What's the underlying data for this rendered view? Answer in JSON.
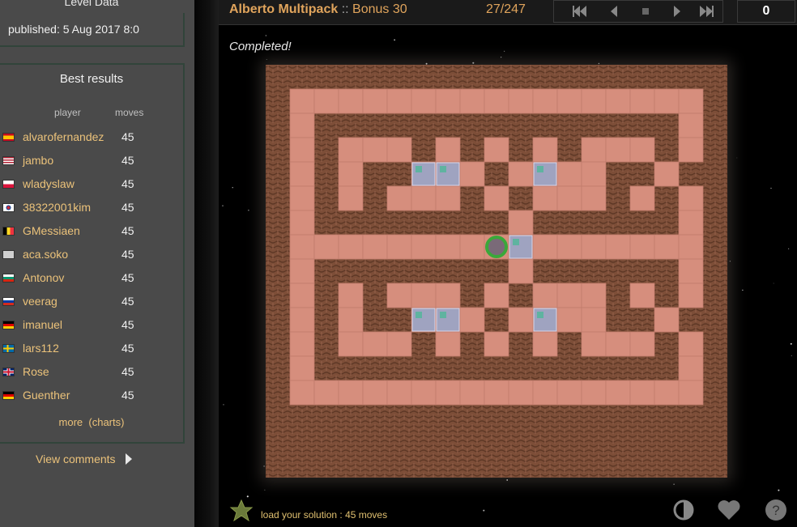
{
  "level_data": {
    "heading": "Level Data",
    "published": "published: 5 Aug 2017 8:0"
  },
  "best_results": {
    "title": "Best results",
    "col_player": "player",
    "col_moves": "moves",
    "rows": [
      {
        "player": "alvarofernandez",
        "moves": "45",
        "flag": "spain-flag"
      },
      {
        "player": "jambo",
        "moves": "45",
        "flag": "usa-flag"
      },
      {
        "player": "wladyslaw",
        "moves": "45",
        "flag": "poland-flag"
      },
      {
        "player": "38322001kim",
        "moves": "45",
        "flag": "south-korea-flag"
      },
      {
        "player": "GMessiaen",
        "moves": "45",
        "flag": "belgium-flag"
      },
      {
        "player": "aca.soko",
        "moves": "45",
        "flag": "blank-flag"
      },
      {
        "player": "Antonov",
        "moves": "45",
        "flag": "bulgaria-flag"
      },
      {
        "player": "veerag",
        "moves": "45",
        "flag": "russia-flag"
      },
      {
        "player": "imanuel",
        "moves": "45",
        "flag": "germany-flag"
      },
      {
        "player": "lars112",
        "moves": "45",
        "flag": "sweden-flag"
      },
      {
        "player": "Rose",
        "moves": "45",
        "flag": "uk-flag"
      },
      {
        "player": "Guenther",
        "moves": "45",
        "flag": "germany-flag"
      }
    ],
    "more": "more",
    "charts": "(charts)"
  },
  "comments": {
    "label": "View comments"
  },
  "topbar": {
    "pack": "Alberto Multipack",
    "separator": "::",
    "level": "Bonus 30",
    "counter": "27/247",
    "moves": "0",
    "nav_icons": [
      "rewind-to-start-icon",
      "step-back-icon",
      "stop-icon",
      "step-forward-icon",
      "fast-forward-icon"
    ]
  },
  "status": "Completed!",
  "bottom": {
    "load_solution": "load your solution : 45 moves",
    "icons": [
      "star-icon",
      "contrast-icon",
      "heart-icon",
      "help-icon"
    ]
  },
  "colors": {
    "floor": "#d68e7d",
    "wall": "#7d4e38",
    "box_on_goal": "#9fa3c0",
    "player_ring": "#3aa83a",
    "accent": "#e0a45c",
    "link": "#ebc27a"
  },
  "board": {
    "grid": [
      "###################",
      "#                 #",
      "# ############### #",
      "# #   # # # #   # #",
      "# # ##** # *  ## #",
      "# # #   # #   # # #",
      "# ######## ###### #",
      "#        @*       #",
      "# ######## ###### #",
      "# # #   # #   # # #",
      "# # ##** # *  ## #",
      "# #   # # # #   # #",
      "# ############### #",
      "#                 #",
      "###################"
    ]
  }
}
